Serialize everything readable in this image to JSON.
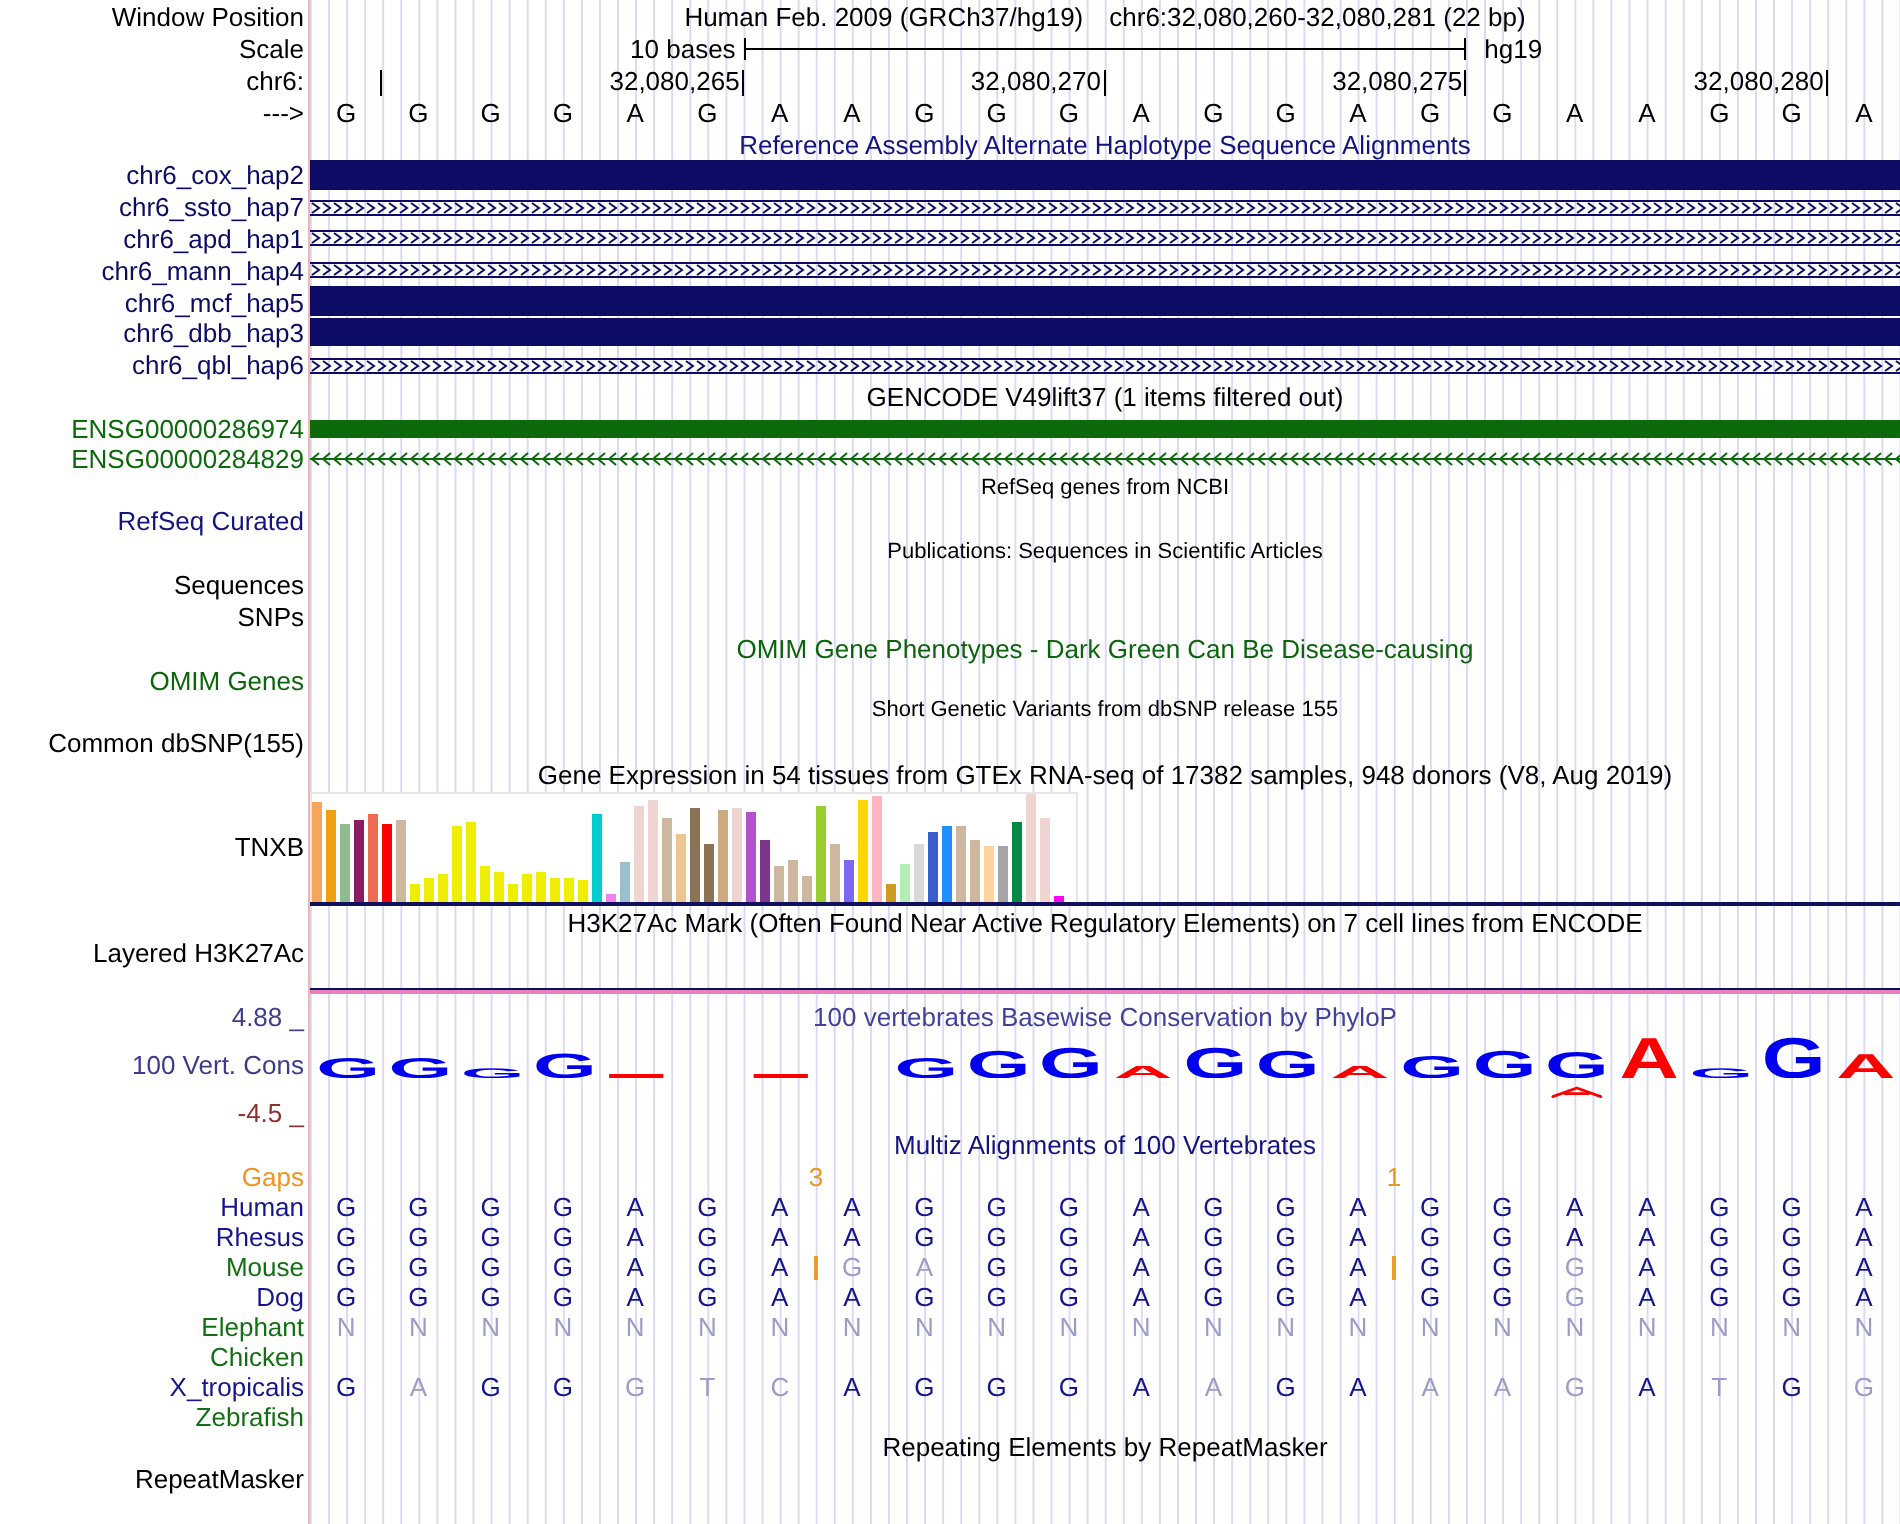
{
  "header": {
    "window_position": {
      "label": "Window Position",
      "assembly": "Human Feb. 2009 (GRCh37/hg19)",
      "position": "chr6:32,080,260-32,080,281 (22 bp)"
    },
    "scale": {
      "label": "Scale",
      "bar_label": "10 bases",
      "assembly": "hg19"
    },
    "ruler": {
      "label": "chr6:",
      "tick_labels": [
        "32,080,265",
        "32,080,270",
        "32,080,275",
        "32,080,280"
      ]
    },
    "sequence": {
      "label": "--->",
      "bases": [
        "G",
        "G",
        "G",
        "G",
        "A",
        "G",
        "A",
        "A",
        "G",
        "G",
        "G",
        "A",
        "G",
        "G",
        "A",
        "G",
        "G",
        "A",
        "A",
        "G",
        "G",
        "A"
      ]
    }
  },
  "tracks": [
    {
      "kind": "haplotypes",
      "title": {
        "text": "Reference Assembly Alternate Haplotype Sequence Alignments",
        "color": "#14147e"
      },
      "color": "#0c0c64",
      "items": [
        {
          "label": "chr6_cox_hap2",
          "kind": "block"
        },
        {
          "label": "chr6_ssto_hap7",
          "kind": "gap_line"
        },
        {
          "label": "chr6_apd_hap1",
          "kind": "gap_line"
        },
        {
          "label": "chr6_mann_hap4",
          "kind": "gap_line"
        },
        {
          "label": "chr6_mcf_hap5",
          "kind": "block"
        },
        {
          "label": "chr6_dbb_hap3",
          "kind": "block"
        },
        {
          "label": "chr6_qbl_hap6",
          "kind": "gap_line"
        }
      ]
    },
    {
      "kind": "genes",
      "title": {
        "text": "GENCODE V49lift37 (1 items filtered out)",
        "color": "#000000"
      },
      "color": "#0c6a0c",
      "items": [
        {
          "label": "ENSG00000286974",
          "kind": "block"
        },
        {
          "label": "ENSG00000284829",
          "kind": "reverse_line"
        }
      ]
    },
    {
      "kind": "group",
      "title": {
        "text": "RefSeq genes from NCBI",
        "color": "#000000"
      },
      "color": "#14147e",
      "labels": [
        "RefSeq Curated"
      ]
    },
    {
      "kind": "group",
      "title": {
        "text": "Publications: Sequences in Scientific Articles",
        "color": "#000000"
      },
      "color": "#000000",
      "labels": [
        "Sequences",
        "SNPs"
      ]
    },
    {
      "kind": "plain",
      "title": {
        "text": "OMIM Gene Phenotypes - Dark Green Can Be Disease-causing",
        "color": "#0c640c"
      },
      "color": "#0c640c",
      "labels": [
        "OMIM Genes"
      ]
    },
    {
      "kind": "group",
      "title": {
        "text": "Short Genetic Variants from dbSNP release 155",
        "color": "#000000"
      },
      "color": "#000000",
      "labels": [
        "Common dbSNP(155)"
      ]
    },
    {
      "kind": "expression",
      "title": {
        "text": "Gene Expression in 54 tissues from GTEx RNA-seq of 17382 samples, 948 donors (V8, Aug 2019)",
        "color": "#000000"
      },
      "color": "#000000",
      "labels": [
        "TNXB"
      ]
    },
    {
      "kind": "signal",
      "title": {
        "text": "H3K27Ac Mark (Often Found Near Active Regulatory Elements) on 7 cell lines from ENCODE",
        "color": "#000000"
      },
      "color": "#000000",
      "labels": [
        "Layered H3K27Ac"
      ]
    },
    {
      "kind": "conservation",
      "title": {
        "text": "100 vertebrates Basewise Conservation by PhyloP",
        "color": "#42429a"
      },
      "color": "#3c3c8c",
      "labels": [
        "100 Vert. Cons"
      ],
      "axis_max": "4.88 _",
      "axis_min": "-4.5 _",
      "logo": [
        {
          "kind": "positive",
          "base": "G"
        },
        {
          "kind": "positive",
          "base": "G"
        },
        {
          "kind": "positive",
          "base": "G"
        },
        {
          "kind": "positive",
          "base": "G"
        },
        {
          "kind": "dash"
        },
        {
          "kind": "empty"
        },
        {
          "kind": "dash"
        },
        {
          "kind": "empty"
        },
        {
          "kind": "positive",
          "base": "G"
        },
        {
          "kind": "positive",
          "base": "G"
        },
        {
          "kind": "positive",
          "base": "G"
        },
        {
          "kind": "negative",
          "base": "A"
        },
        {
          "kind": "positive",
          "base": "G"
        },
        {
          "kind": "positive",
          "base": "G"
        },
        {
          "kind": "negative",
          "base": "A"
        },
        {
          "kind": "positive",
          "base": "G"
        },
        {
          "kind": "positive",
          "base": "G"
        },
        {
          "kind": "mixed",
          "base": "G"
        },
        {
          "kind": "negative",
          "base": "A"
        },
        {
          "kind": "positive",
          "base": "G"
        },
        {
          "kind": "positive",
          "base": "G"
        },
        {
          "kind": "negative",
          "base": "A"
        }
      ]
    },
    {
      "kind": "multiz",
      "title": {
        "text": "Multiz Alignments of 100 Vertebrates",
        "color": "#14147e"
      },
      "gaps": {
        "label": "Gaps",
        "color": "#ee9420",
        "slots": [
          {
            "insertion": false
          },
          {
            "insertion": false
          },
          {
            "insertion": false
          },
          {
            "insertion": false
          },
          {
            "insertion": false
          },
          {
            "insertion": false
          },
          {
            "insertion": true,
            "count": "3"
          },
          {
            "insertion": false
          },
          {
            "insertion": false
          },
          {
            "insertion": false
          },
          {
            "insertion": false
          },
          {
            "insertion": false
          },
          {
            "insertion": false
          },
          {
            "insertion": false
          },
          {
            "insertion": true,
            "count": "1"
          },
          {
            "insertion": false
          },
          {
            "insertion": false
          },
          {
            "insertion": false
          },
          {
            "insertion": false
          },
          {
            "insertion": false
          },
          {
            "insertion": false
          },
          {
            "insertion": false
          }
        ]
      },
      "species": [
        {
          "name": "Human",
          "color": "#16168c",
          "bases": [
            {
              "base": "G",
              "match": true
            },
            {
              "base": "G",
              "match": true
            },
            {
              "base": "G",
              "match": true
            },
            {
              "base": "G",
              "match": true
            },
            {
              "base": "A",
              "match": true
            },
            {
              "base": "G",
              "match": true
            },
            {
              "base": "A",
              "match": true
            },
            {
              "base": "A",
              "match": true
            },
            {
              "base": "G",
              "match": true
            },
            {
              "base": "G",
              "match": true
            },
            {
              "base": "G",
              "match": true
            },
            {
              "base": "A",
              "match": true
            },
            {
              "base": "G",
              "match": true
            },
            {
              "base": "G",
              "match": true
            },
            {
              "base": "A",
              "match": true
            },
            {
              "base": "G",
              "match": true
            },
            {
              "base": "G",
              "match": true
            },
            {
              "base": "A",
              "match": true
            },
            {
              "base": "A",
              "match": true
            },
            {
              "base": "G",
              "match": true
            },
            {
              "base": "G",
              "match": true
            },
            {
              "base": "A",
              "match": true
            }
          ]
        },
        {
          "name": "Rhesus",
          "color": "#16168c",
          "bases": [
            {
              "base": "G",
              "match": true
            },
            {
              "base": "G",
              "match": true
            },
            {
              "base": "G",
              "match": true
            },
            {
              "base": "G",
              "match": true
            },
            {
              "base": "A",
              "match": true
            },
            {
              "base": "G",
              "match": true
            },
            {
              "base": "A",
              "match": true
            },
            {
              "base": "A",
              "match": true
            },
            {
              "base": "G",
              "match": true
            },
            {
              "base": "G",
              "match": true
            },
            {
              "base": "G",
              "match": true
            },
            {
              "base": "A",
              "match": true
            },
            {
              "base": "G",
              "match": true
            },
            {
              "base": "G",
              "match": true
            },
            {
              "base": "A",
              "match": true
            },
            {
              "base": "G",
              "match": true
            },
            {
              "base": "G",
              "match": true
            },
            {
              "base": "A",
              "match": true
            },
            {
              "base": "A",
              "match": true
            },
            {
              "base": "G",
              "match": true
            },
            {
              "base": "G",
              "match": true
            },
            {
              "base": "A",
              "match": true
            }
          ]
        },
        {
          "name": "Mouse",
          "color": "#127012",
          "bases": [
            {
              "base": "G",
              "match": true,
              "insertion": false
            },
            {
              "base": "G",
              "match": true,
              "insertion": false
            },
            {
              "base": "G",
              "match": true,
              "insertion": false
            },
            {
              "base": "G",
              "match": true,
              "insertion": false
            },
            {
              "base": "A",
              "match": true,
              "insertion": false
            },
            {
              "base": "G",
              "match": true,
              "insertion": false
            },
            {
              "base": "A",
              "match": true,
              "insertion": true
            },
            {
              "base": "G",
              "match": false,
              "insertion": false
            },
            {
              "base": "A",
              "match": false,
              "insertion": false
            },
            {
              "base": "G",
              "match": true,
              "insertion": false
            },
            {
              "base": "G",
              "match": true,
              "insertion": false
            },
            {
              "base": "A",
              "match": true,
              "insertion": false
            },
            {
              "base": "G",
              "match": true,
              "insertion": false
            },
            {
              "base": "G",
              "match": true,
              "insertion": false
            },
            {
              "base": "A",
              "match": true,
              "insertion": true
            },
            {
              "base": "G",
              "match": true,
              "insertion": false
            },
            {
              "base": "G",
              "match": true,
              "insertion": false
            },
            {
              "base": "G",
              "match": false,
              "insertion": false
            },
            {
              "base": "A",
              "match": true,
              "insertion": false
            },
            {
              "base": "G",
              "match": true,
              "insertion": false
            },
            {
              "base": "G",
              "match": true,
              "insertion": false
            },
            {
              "base": "A",
              "match": true,
              "insertion": false
            }
          ]
        },
        {
          "name": "Dog",
          "color": "#16168c",
          "bases": [
            {
              "base": "G",
              "match": true
            },
            {
              "base": "G",
              "match": true
            },
            {
              "base": "G",
              "match": true
            },
            {
              "base": "G",
              "match": true
            },
            {
              "base": "A",
              "match": true
            },
            {
              "base": "G",
              "match": true
            },
            {
              "base": "A",
              "match": true
            },
            {
              "base": "A",
              "match": true
            },
            {
              "base": "G",
              "match": true
            },
            {
              "base": "G",
              "match": true
            },
            {
              "base": "G",
              "match": true
            },
            {
              "base": "A",
              "match": true
            },
            {
              "base": "G",
              "match": true
            },
            {
              "base": "G",
              "match": true
            },
            {
              "base": "A",
              "match": true
            },
            {
              "base": "G",
              "match": true
            },
            {
              "base": "G",
              "match": true
            },
            {
              "base": "G",
              "match": false
            },
            {
              "base": "A",
              "match": true
            },
            {
              "base": "G",
              "match": true
            },
            {
              "base": "G",
              "match": true
            },
            {
              "base": "A",
              "match": true
            }
          ]
        },
        {
          "name": "Elephant",
          "color": "#127012",
          "bases": [
            {
              "base": "N",
              "match": false
            },
            {
              "base": "N",
              "match": false
            },
            {
              "base": "N",
              "match": false
            },
            {
              "base": "N",
              "match": false
            },
            {
              "base": "N",
              "match": false
            },
            {
              "base": "N",
              "match": false
            },
            {
              "base": "N",
              "match": false
            },
            {
              "base": "N",
              "match": false
            },
            {
              "base": "N",
              "match": false
            },
            {
              "base": "N",
              "match": false
            },
            {
              "base": "N",
              "match": false
            },
            {
              "base": "N",
              "match": false
            },
            {
              "base": "N",
              "match": false
            },
            {
              "base": "N",
              "match": false
            },
            {
              "base": "N",
              "match": false
            },
            {
              "base": "N",
              "match": false
            },
            {
              "base": "N",
              "match": false
            },
            {
              "base": "N",
              "match": false
            },
            {
              "base": "N",
              "match": false
            },
            {
              "base": "N",
              "match": false
            },
            {
              "base": "N",
              "match": false
            },
            {
              "base": "N",
              "match": false
            }
          ]
        },
        {
          "name": "Chicken",
          "color": "#127012"
        },
        {
          "name": "X_tropicalis",
          "color": "#16168c",
          "bases": [
            {
              "base": "G",
              "match": true
            },
            {
              "base": "A",
              "match": false
            },
            {
              "base": "G",
              "match": true
            },
            {
              "base": "G",
              "match": true
            },
            {
              "base": "G",
              "match": false
            },
            {
              "base": "T",
              "match": false
            },
            {
              "base": "C",
              "match": false
            },
            {
              "base": "A",
              "match": true
            },
            {
              "base": "G",
              "match": true
            },
            {
              "base": "G",
              "match": true
            },
            {
              "base": "G",
              "match": true
            },
            {
              "base": "A",
              "match": true
            },
            {
              "base": "A",
              "match": false
            },
            {
              "base": "G",
              "match": true
            },
            {
              "base": "A",
              "match": true
            },
            {
              "base": "A",
              "match": false
            },
            {
              "base": "A",
              "match": false
            },
            {
              "base": "G",
              "match": false
            },
            {
              "base": "A",
              "match": true
            },
            {
              "base": "T",
              "match": false
            },
            {
              "base": "G",
              "match": true
            },
            {
              "base": "G",
              "match": false
            }
          ]
        },
        {
          "name": "Zebrafish",
          "color": "#127012"
        }
      ]
    },
    {
      "kind": "plain",
      "title": {
        "text": "Repeating Elements by RepeatMasker",
        "color": "#000000"
      },
      "color": "#000000",
      "labels": [
        "RepeatMasker"
      ]
    }
  ]
}
